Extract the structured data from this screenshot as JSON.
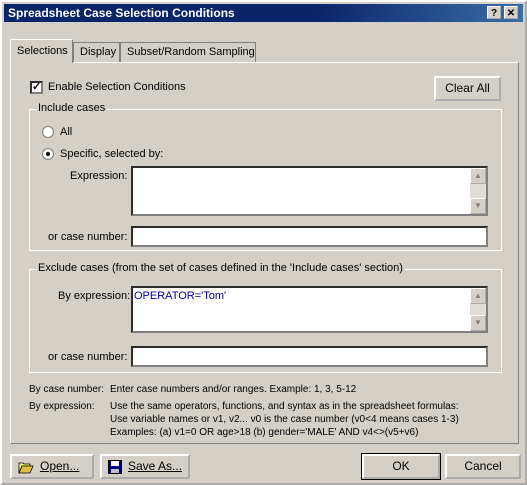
{
  "window": {
    "title": "Spreadsheet Case Selection Conditions",
    "help_btn": "?",
    "close_btn": "✕"
  },
  "tabs": [
    {
      "label": "Selections",
      "active": true
    },
    {
      "label": "Display",
      "active": false
    },
    {
      "label": "Subset/Random Sampling",
      "active": false
    }
  ],
  "enable": {
    "label": "Enable Selection Conditions",
    "checked": true
  },
  "clear_all": "Clear All",
  "include": {
    "title": "Include cases",
    "all_label": "All",
    "specific_label": "Specific, selected by:",
    "selected": "specific",
    "expression_label": "Expression:",
    "expression_value": "",
    "case_number_label": "or case number:",
    "case_number_value": ""
  },
  "exclude": {
    "title": "Exclude cases (from the set of cases defined in the 'Include cases' section)",
    "expression_label": "By expression:",
    "expression_value": "OPERATOR='Tom'",
    "case_number_label": "or case number:",
    "case_number_value": ""
  },
  "help": {
    "case_label": "By case number:",
    "case_text": "Enter case numbers and/or ranges.  Example:  1, 3, 5-12",
    "expr_label": "By expression:",
    "expr_line1": "Use the same operators, functions, and syntax as in the spreadsheet formulas:",
    "expr_line2": "Use variable names or v1, v2...   v0 is the case number  (v0<4 means cases 1-3)",
    "expr_line3": "Examples:  (a) v1=0 OR age>18  (b) gender='MALE' AND v4<>(v5+v6)"
  },
  "buttons": {
    "open": "Open...",
    "save_as": "Save As...",
    "ok": "OK",
    "cancel": "Cancel"
  },
  "icons": {
    "folder": "open-folder-icon",
    "disk": "floppy-disk-icon"
  },
  "colors": {
    "title_bg": "#0a246a",
    "face": "#d4d0c8",
    "expr_text": "#0000a0"
  }
}
